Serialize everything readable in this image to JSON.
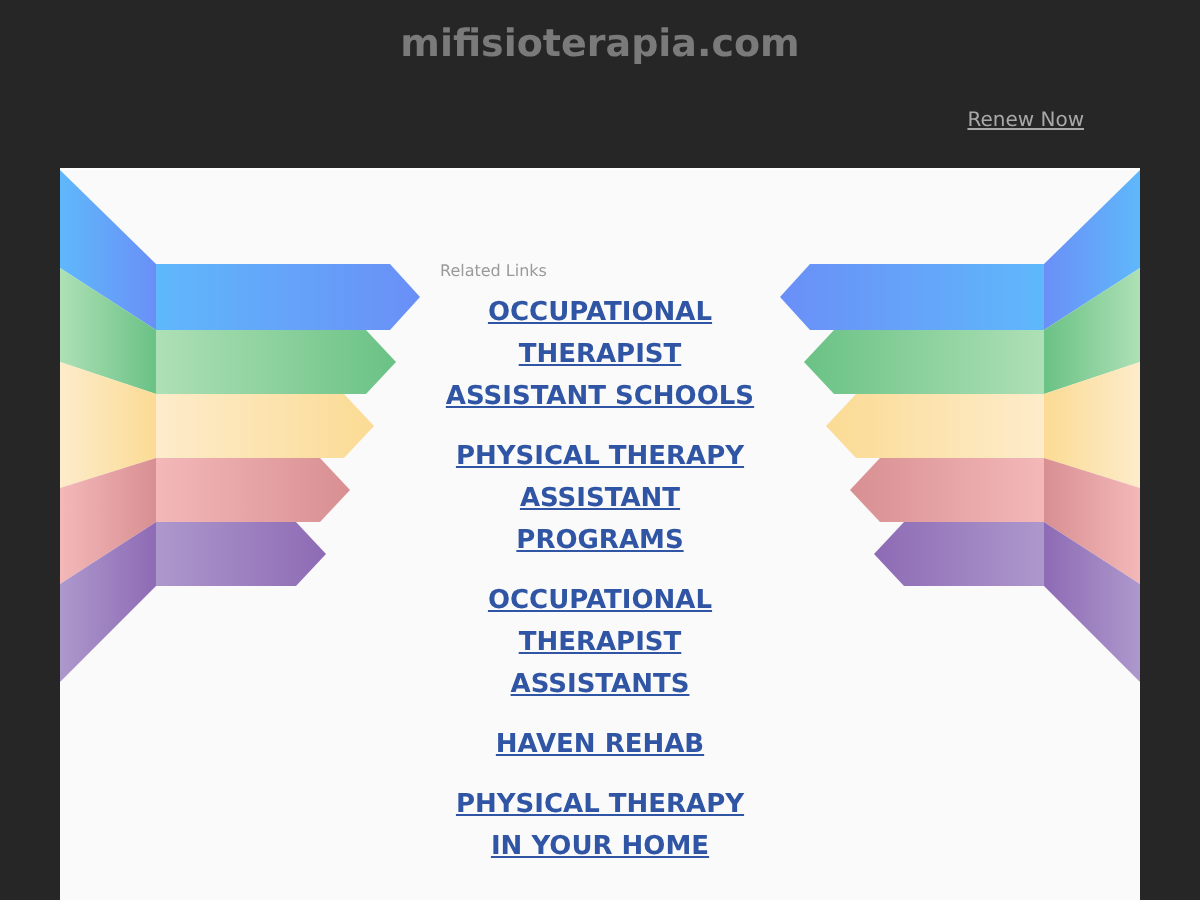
{
  "site_title": "mifisioterapia.com",
  "renew_link": "Renew Now",
  "related_heading": "Related Links",
  "links": [
    "OCCUPATIONAL THERAPIST ASSISTANT SCHOOLS",
    "PHYSICAL THERAPY ASSISTANT PROGRAMS",
    "OCCUPATIONAL THERAPIST ASSISTANTS",
    "HAVEN REHAB",
    "PHYSICAL THERAPY IN YOUR HOME"
  ]
}
